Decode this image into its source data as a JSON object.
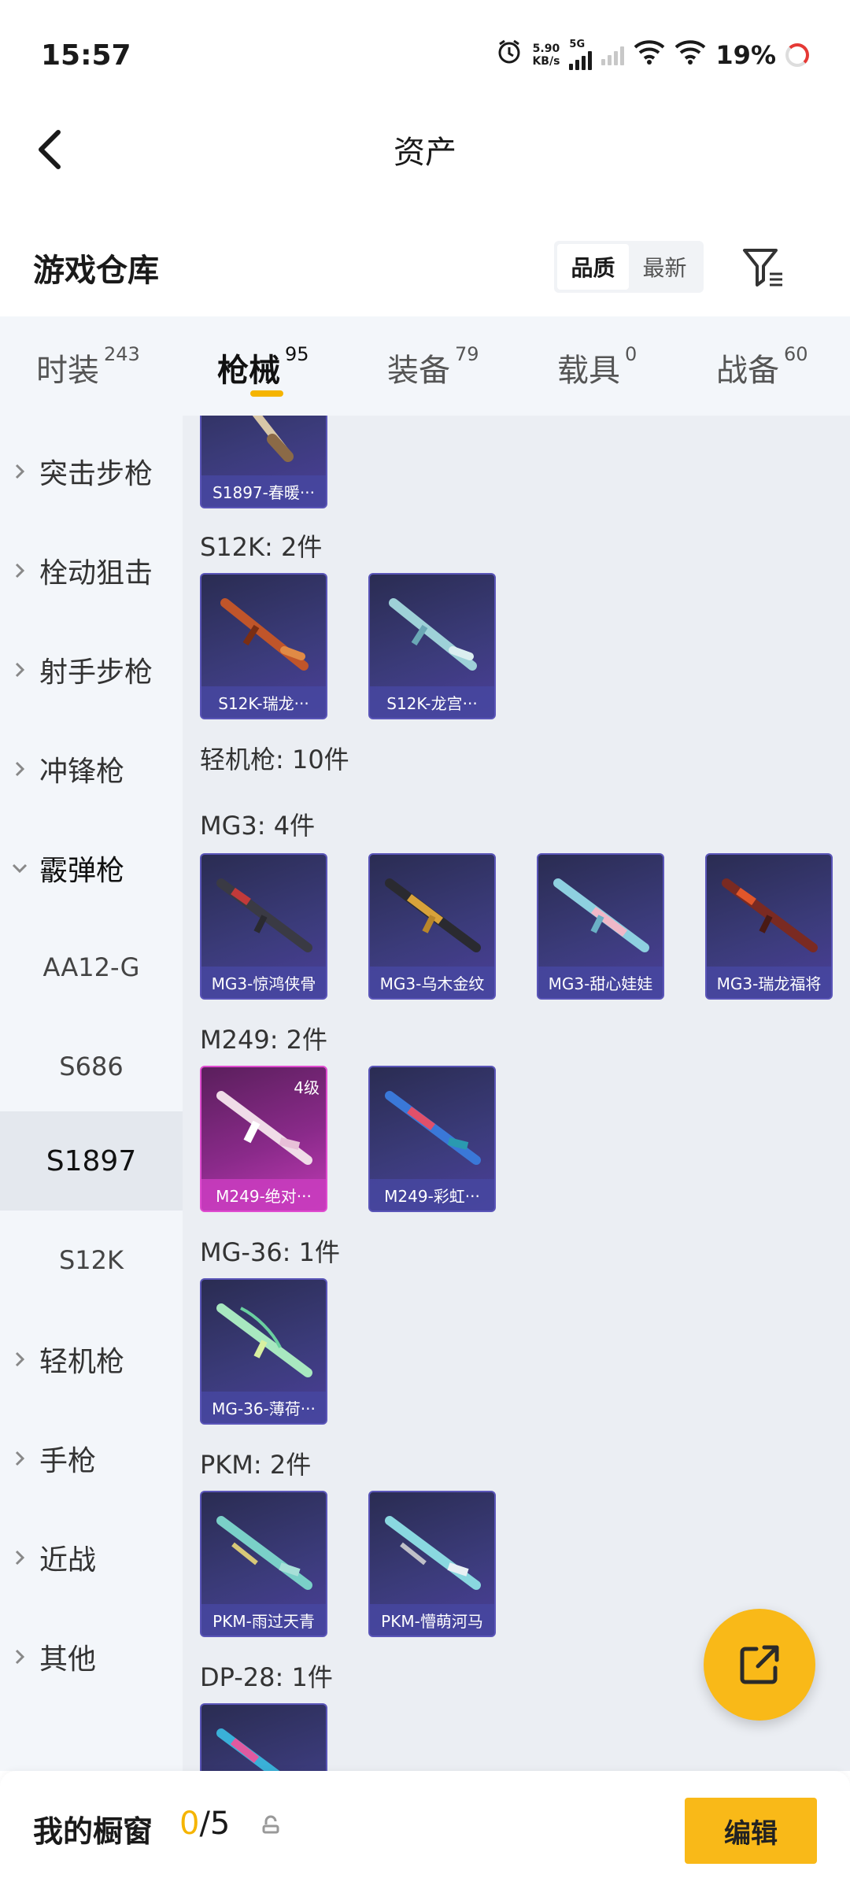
{
  "status_bar": {
    "time": "15:57",
    "net_speed_value": "5.90",
    "net_speed_unit": "KB/s",
    "network_type": "5G",
    "battery": "19%"
  },
  "header": {
    "title": "资产"
  },
  "warehouse": {
    "title": "游戏仓库",
    "sort_options": [
      "品质",
      "最新"
    ],
    "sort_active": "品质"
  },
  "category_tabs": [
    {
      "label": "时装",
      "count": "243"
    },
    {
      "label": "枪械",
      "count": "95",
      "active": true
    },
    {
      "label": "装备",
      "count": "79"
    },
    {
      "label": "载具",
      "count": "0"
    },
    {
      "label": "战备",
      "count": "60"
    }
  ],
  "sidebar": {
    "items": [
      {
        "label": "突击步枪"
      },
      {
        "label": "栓动狙击"
      },
      {
        "label": "射手步枪"
      },
      {
        "label": "冲锋枪"
      },
      {
        "label": "霰弹枪"
      },
      {
        "label": "AA12-G"
      },
      {
        "label": "S686"
      },
      {
        "label": "S1897"
      },
      {
        "label": "S12K"
      },
      {
        "label": "轻机枪"
      },
      {
        "label": "手枪"
      },
      {
        "label": "近战"
      },
      {
        "label": "其他"
      }
    ]
  },
  "content": {
    "top_card": "S1897-春暖···",
    "s12k_label": "S12K: 2件",
    "s12k_cards": [
      "S12K-瑞龙···",
      "S12K-龙宫···"
    ],
    "lmg_label": "轻机枪: 10件",
    "mg3_label": "MG3: 4件",
    "mg3_cards": [
      "MG3-惊鸿侠骨",
      "MG3-乌木金纹",
      "MG3-甜心娃娃",
      "MG3-瑞龙福将"
    ],
    "m249_label": "M249: 2件",
    "m249_cards": [
      "M249-绝对···",
      "M249-彩虹···"
    ],
    "m249_tier": "4级",
    "mg36_label": "MG-36: 1件",
    "mg36_cards": [
      "MG-36-薄荷···"
    ],
    "pkm_label": "PKM: 2件",
    "pkm_cards": [
      "PKM-雨过天青",
      "PKM-懵萌河马"
    ],
    "dp28_label": "DP-28: 1件"
  },
  "bottom_bar": {
    "title": "我的橱窗",
    "current": "0",
    "total": "/5",
    "edit_label": "编辑"
  },
  "colors": {
    "accent": "#f9b918",
    "card_purple": "#3b3b7a",
    "card_pink": "#c13bb5"
  }
}
